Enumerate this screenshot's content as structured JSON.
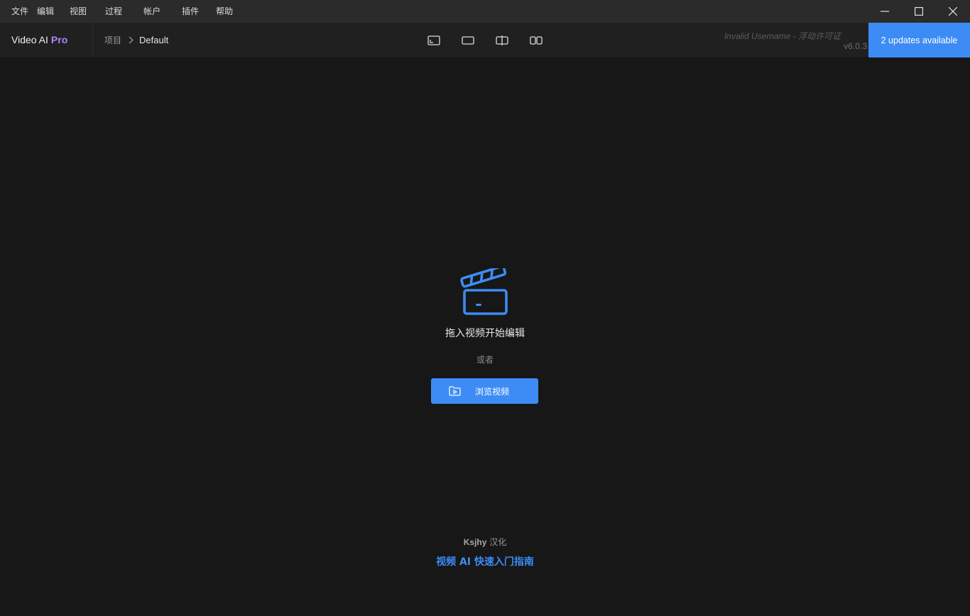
{
  "menubar": {
    "items": [
      "文件",
      "编辑",
      "视图",
      "过程",
      "帐户",
      "插件",
      "帮助"
    ]
  },
  "window_controls": {
    "minimize_icon": "minimize-icon",
    "maximize_icon": "maximize-icon",
    "close_icon": "close-icon"
  },
  "header": {
    "brand": "Video AI",
    "brand_edition": "Pro",
    "breadcrumb": {
      "root": "项目",
      "current": "Default"
    },
    "view_modes": [
      "single-view-icon",
      "full-view-icon",
      "split-view-icon",
      "side-by-side-view-icon"
    ],
    "license_text": "Invalid Username - 浮动许可证",
    "version": "v6.0.3",
    "updates_label": "2 updates available"
  },
  "dropzone": {
    "icon": "clapperboard-icon",
    "title": "拖入视频开始编辑",
    "or_text": "或者",
    "browse_label": "浏览视频",
    "browse_icon": "folder-video-icon"
  },
  "footer": {
    "credit_name": "Ksjhy",
    "credit_suffix": " 汉化",
    "guide_link": "视频 AI 快速入门指南"
  },
  "colors": {
    "accent": "#3d8cf5",
    "pro": "#b382ff",
    "background": "#171717",
    "header": "#202020",
    "menubar": "#2b2b2b"
  }
}
